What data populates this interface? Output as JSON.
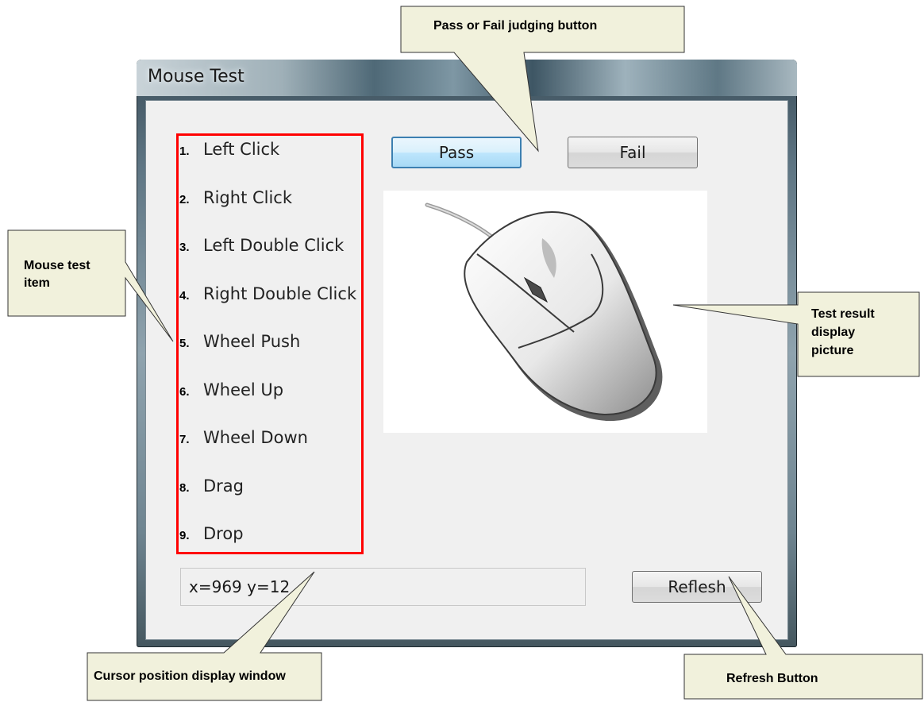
{
  "window": {
    "title": "Mouse Test"
  },
  "test_items": [
    {
      "num": "1.",
      "label": "Left Click"
    },
    {
      "num": "2.",
      "label": "Right Click"
    },
    {
      "num": "3.",
      "label": "Left Double Click"
    },
    {
      "num": "4.",
      "label": "Right Double Click"
    },
    {
      "num": "5.",
      "label": "Wheel Push"
    },
    {
      "num": "6.",
      "label": "Wheel Up"
    },
    {
      "num": "7.",
      "label": "Wheel Down"
    },
    {
      "num": "8.",
      "label": "Drag"
    },
    {
      "num": "9.",
      "label": "Drop"
    }
  ],
  "buttons": {
    "pass": "Pass",
    "fail": "Fail",
    "refresh": "Reflesh"
  },
  "cursor_position": {
    "text": "x=969 y=12"
  },
  "callouts": {
    "judging": "Pass or Fail judging button",
    "items_line1": "Mouse test",
    "items_line2": "item",
    "result_line1": "Test result",
    "result_line2": "display",
    "result_line3": "picture",
    "cursor": "Cursor position display window",
    "refresh": "Refresh  Button"
  },
  "colors": {
    "item_box_border": "#ff0000",
    "callout_fill": "#f1f1dc",
    "focus_border": "#3c7fb1",
    "client_bg": "#f0f0f0"
  },
  "icons": {
    "result_picture": "computer-mouse-icon"
  }
}
